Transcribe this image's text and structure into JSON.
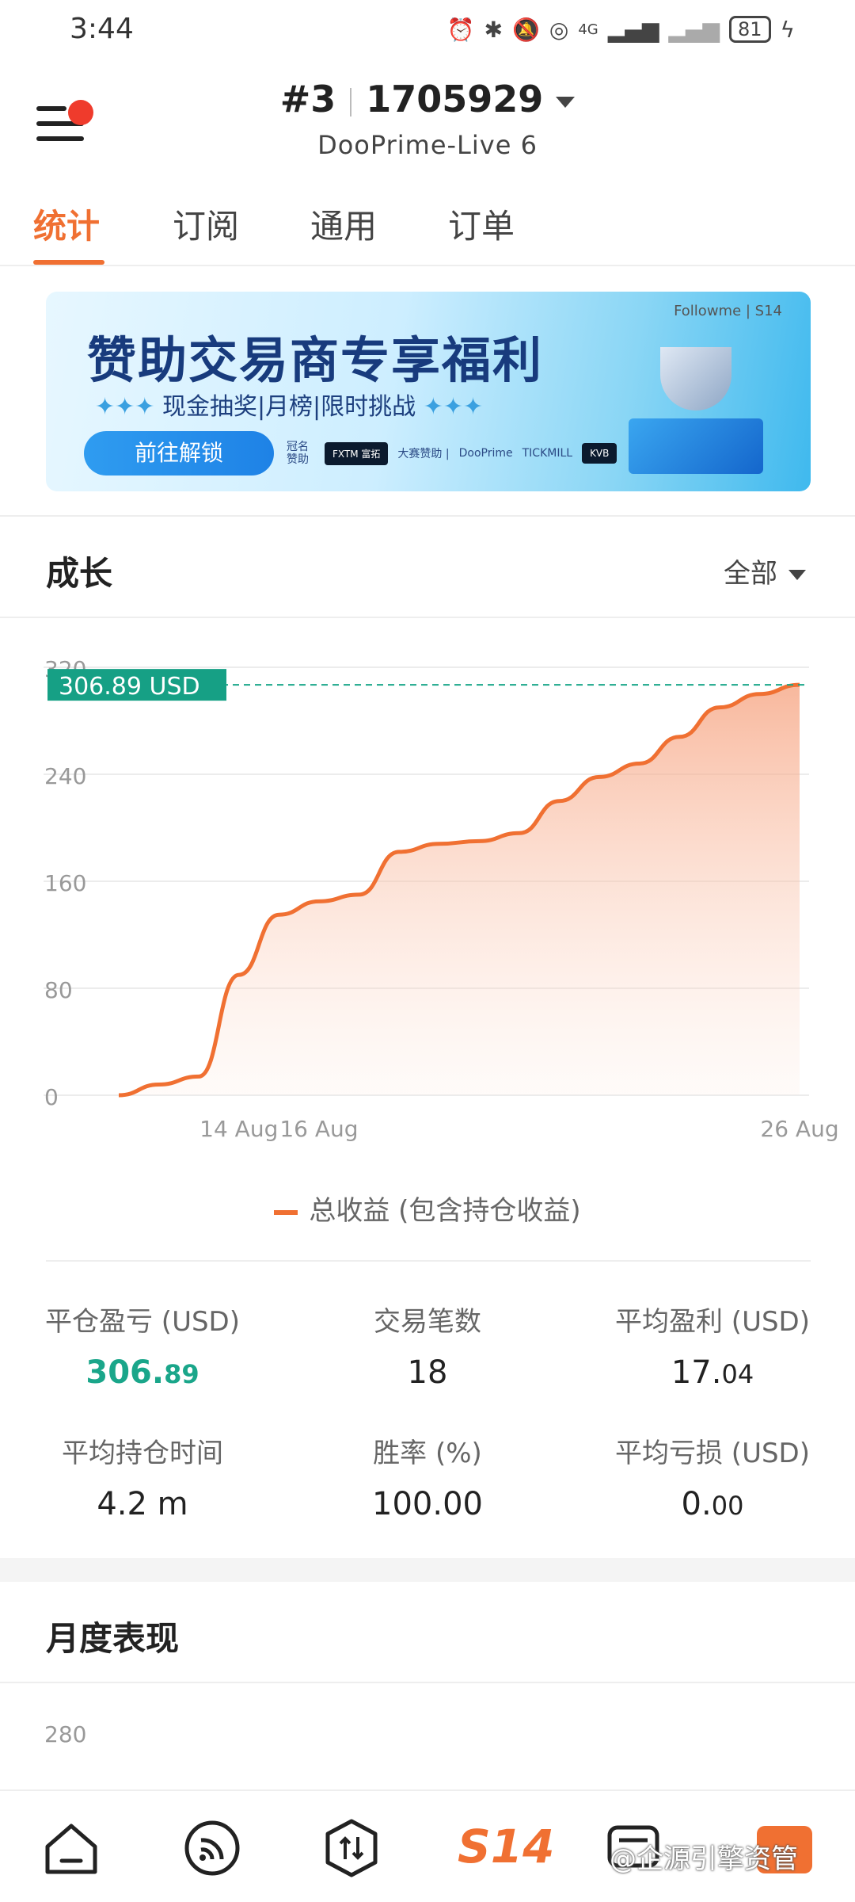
{
  "status_bar": {
    "time": "3:44",
    "battery": "81",
    "net": "4G"
  },
  "header": {
    "account_rank": "#3",
    "account_id": "1705929",
    "server": "DooPrime-Live 6"
  },
  "tabs": [
    {
      "label": "统计",
      "active": true
    },
    {
      "label": "订阅",
      "active": false
    },
    {
      "label": "通用",
      "active": false
    },
    {
      "label": "订单",
      "active": false
    }
  ],
  "banner": {
    "brand": "Followme | S14",
    "title": "赞助交易商专享福利",
    "subtitle": "现金抽奖|月榜|限时挑战",
    "cta": "前往解锁",
    "sponsor_label": "冠名赞助",
    "sponsors": [
      "FXTM 富拓",
      "大赛赞助 |",
      "DooPrime",
      "TICKMILL",
      "KVB"
    ]
  },
  "growth": {
    "title": "成长",
    "filter": "全部",
    "current_value_label": "306.89 USD",
    "legend": "总收益 (包含持仓收益)"
  },
  "chart_data": {
    "type": "area",
    "title": "",
    "xlabel": "",
    "ylabel": "",
    "ylim": [
      0,
      320
    ],
    "yticks": [
      0,
      80,
      160,
      240,
      320
    ],
    "x_tick_labels": [
      "14 Aug",
      "16 Aug",
      "26 Aug"
    ],
    "x_tick_index": [
      3,
      5,
      17
    ],
    "series": [
      {
        "name": "总收益 (包含持仓收益)",
        "values": [
          0,
          8,
          14,
          90,
          135,
          145,
          150,
          182,
          188,
          190,
          196,
          220,
          238,
          248,
          268,
          290,
          300,
          306.89
        ]
      }
    ],
    "reference_value": 306.89,
    "color": "#f07032"
  },
  "stats": [
    {
      "label": "平仓盈亏 (USD)",
      "int": "306.",
      "dec": "89",
      "highlight": true
    },
    {
      "label": "交易笔数",
      "int": "18",
      "dec": "",
      "highlight": false
    },
    {
      "label": "平均盈利 (USD)",
      "int": "17.",
      "dec": "04",
      "highlight": false
    },
    {
      "label": "平均持仓时间",
      "int": "4.2 m",
      "dec": "",
      "highlight": false
    },
    {
      "label": "胜率 (%)",
      "int": "100.00",
      "dec": "",
      "highlight": false
    },
    {
      "label": "平均亏损 (USD)",
      "int": "0.",
      "dec": "00",
      "highlight": false
    }
  ],
  "monthly": {
    "title": "月度表现",
    "first_tick": "280"
  },
  "bottom_nav": {
    "items": [
      "home-icon",
      "feed-icon",
      "trade-icon",
      "s14-icon",
      "message-icon",
      "badge-icon"
    ],
    "s14_label": "S14"
  },
  "watermark": "@企源引擎资管"
}
